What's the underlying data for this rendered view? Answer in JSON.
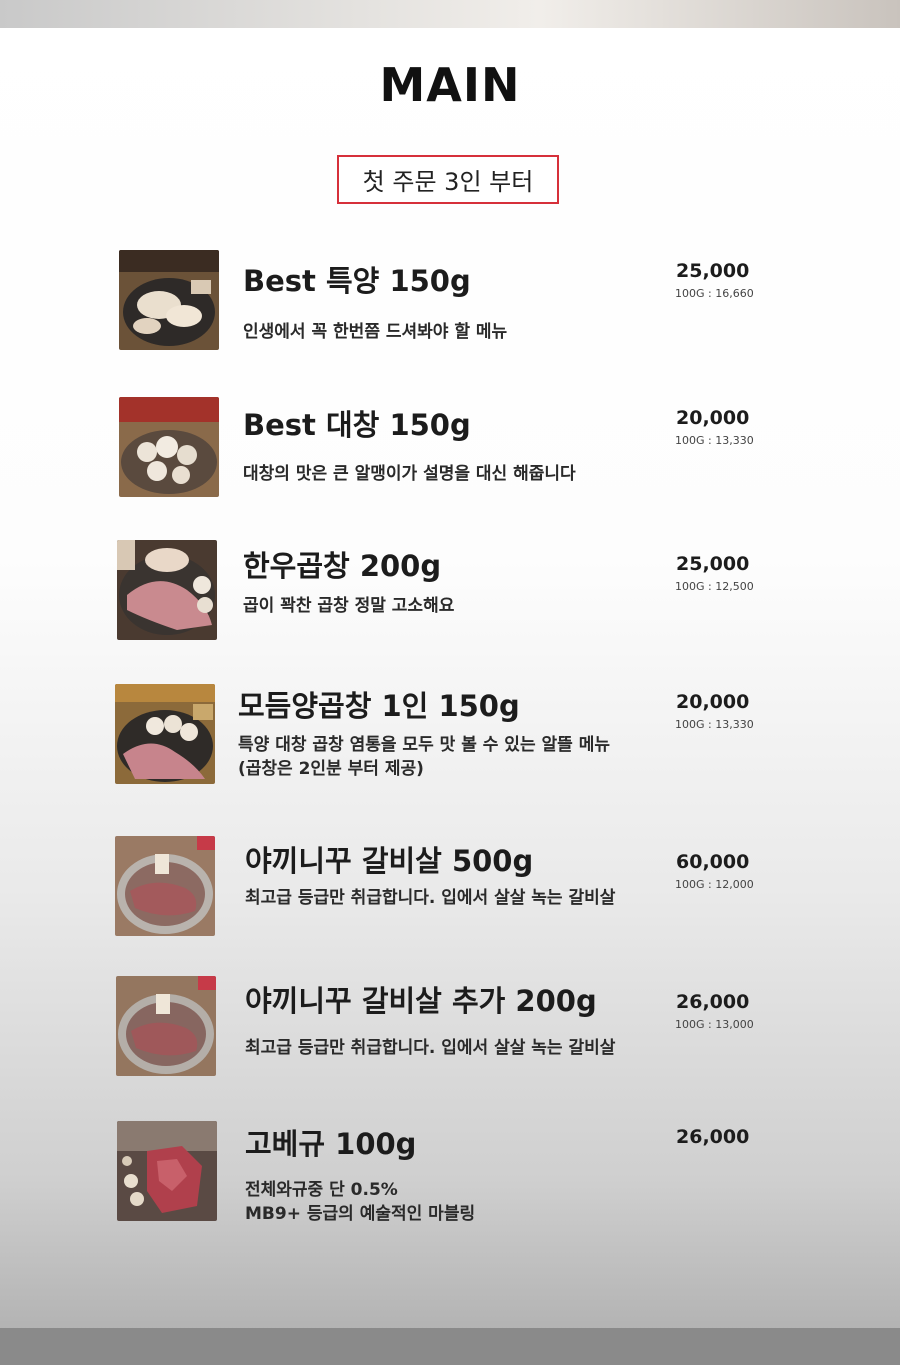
{
  "header": {
    "title": "MAIN",
    "notice": "첫 주문 3인 부터"
  },
  "items": [
    {
      "name": "Best 특양 150g",
      "desc": [
        "인생에서 꼭 한번쯤 드셔봐야 할 메뉴"
      ],
      "price": "25,000",
      "per100g": "100G : 16,660"
    },
    {
      "name": "Best 대창 150g",
      "desc": [
        "대창의 맛은 큰 알맹이가 설명을 대신 해줍니다"
      ],
      "price": "20,000",
      "per100g": "100G : 13,330"
    },
    {
      "name": "한우곱창 200g",
      "desc": [
        "곱이 꽉찬 곱창 정말 고소해요"
      ],
      "price": "25,000",
      "per100g": "100G : 12,500"
    },
    {
      "name": "모듬양곱창 1인 150g",
      "desc": [
        "특양 대창 곱창 염통을 모두 맛 볼 수 있는 알뜰 메뉴",
        "(곱창은 2인분 부터 제공)"
      ],
      "price": "20,000",
      "per100g": "100G : 13,330"
    },
    {
      "name": "야끼니꾸 갈비살 500g",
      "desc": [
        "최고급 등급만 취급합니다. 입에서 살살 녹는 갈비살"
      ],
      "price": "60,000",
      "per100g": "100G : 12,000"
    },
    {
      "name": "야끼니꾸 갈비살 추가 200g",
      "desc": [
        "최고급 등급만 취급합니다. 입에서 살살 녹는 갈비살"
      ],
      "price": "26,000",
      "per100g": "100G : 13,000"
    },
    {
      "name": "고베규 100g",
      "desc": [
        "전체와규중 단 0.5%",
        "MB9+ 등급의 예술적인 마블링"
      ],
      "price": "26,000",
      "per100g": ""
    }
  ]
}
